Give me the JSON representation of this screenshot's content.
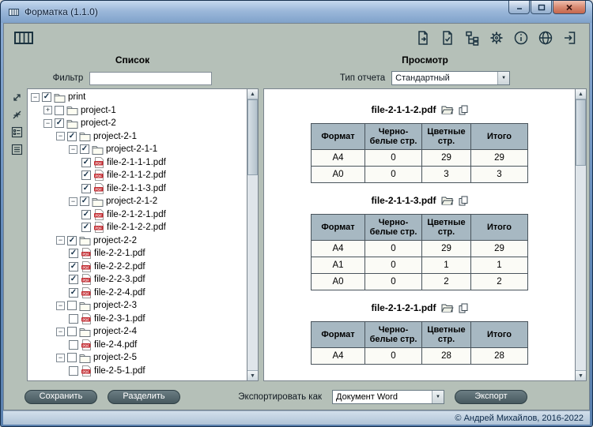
{
  "colors": {
    "frame_blue": "#6f94c0",
    "client_bg": "#b5c0b8",
    "table_header_bg": "#a7b8c2",
    "dark_button": "#51656b",
    "pdf_red": "#c1272d"
  },
  "window": {
    "title": "Форматка (1.1.0)",
    "controls": [
      "minimize-button",
      "maximize-button",
      "close-button"
    ]
  },
  "toolbar": {
    "icons": [
      "document-export-icon",
      "document-check-icon",
      "tree-structure-icon",
      "settings-gear-icon",
      "info-icon",
      "globe-icon",
      "exit-icon"
    ]
  },
  "left_panel": {
    "title": "Список",
    "filter_label": "Фильтр",
    "filter_value": "",
    "tools": [
      "expand-all-icon",
      "collapse-all-icon",
      "check-all-icon",
      "uncheck-all-icon"
    ],
    "tree": [
      {
        "label": "print",
        "type": "folder",
        "level": 0,
        "expander": "minus",
        "checked": true
      },
      {
        "label": "project-1",
        "type": "folder",
        "level": 1,
        "expander": "plus",
        "checked": false
      },
      {
        "label": "project-2",
        "type": "folder",
        "level": 1,
        "expander": "minus",
        "checked": true
      },
      {
        "label": "project-2-1",
        "type": "folder",
        "level": 2,
        "expander": "minus",
        "checked": true
      },
      {
        "label": "project-2-1-1",
        "type": "folder",
        "level": 3,
        "expander": "minus",
        "checked": true
      },
      {
        "label": "file-2-1-1-1.pdf",
        "type": "pdf",
        "level": 4,
        "checked": true
      },
      {
        "label": "file-2-1-1-2.pdf",
        "type": "pdf",
        "level": 4,
        "checked": true
      },
      {
        "label": "file-2-1-1-3.pdf",
        "type": "pdf",
        "level": 4,
        "checked": true
      },
      {
        "label": "project-2-1-2",
        "type": "folder",
        "level": 3,
        "expander": "minus",
        "checked": true
      },
      {
        "label": "file-2-1-2-1.pdf",
        "type": "pdf",
        "level": 4,
        "checked": true
      },
      {
        "label": "file-2-1-2-2.pdf",
        "type": "pdf",
        "level": 4,
        "checked": true
      },
      {
        "label": "project-2-2",
        "type": "folder",
        "level": 2,
        "expander": "minus",
        "checked": true
      },
      {
        "label": "file-2-2-1.pdf",
        "type": "pdf",
        "level": 3,
        "checked": true
      },
      {
        "label": "file-2-2-2.pdf",
        "type": "pdf",
        "level": 3,
        "checked": true
      },
      {
        "label": "file-2-2-3.pdf",
        "type": "pdf",
        "level": 3,
        "checked": true
      },
      {
        "label": "file-2-2-4.pdf",
        "type": "pdf",
        "level": 3,
        "checked": true
      },
      {
        "label": "project-2-3",
        "type": "folder",
        "level": 2,
        "expander": "minus",
        "checked": false
      },
      {
        "label": "file-2-3-1.pdf",
        "type": "pdf",
        "level": 3,
        "checked": false
      },
      {
        "label": "project-2-4",
        "type": "folder",
        "level": 2,
        "expander": "minus",
        "checked": false
      },
      {
        "label": "file-2-4.pdf",
        "type": "pdf",
        "level": 3,
        "checked": false
      },
      {
        "label": "project-2-5",
        "type": "folder",
        "level": 2,
        "expander": "minus",
        "checked": false
      },
      {
        "label": "file-2-5-1.pdf",
        "type": "pdf",
        "level": 3,
        "checked": false
      }
    ]
  },
  "right_panel": {
    "title": "Просмотр",
    "report_type_label": "Тип отчета",
    "report_type_value": "Стандартный",
    "table_headers": [
      "Формат",
      "Черно-белые стр.",
      "Цветные стр.",
      "Итого"
    ],
    "reports": [
      {
        "filename": "file-2-1-1-2.pdf",
        "rows": [
          [
            "A4",
            "0",
            "29",
            "29"
          ],
          [
            "A0",
            "0",
            "3",
            "3"
          ]
        ]
      },
      {
        "filename": "file-2-1-1-3.pdf",
        "rows": [
          [
            "A4",
            "0",
            "29",
            "29"
          ],
          [
            "A1",
            "0",
            "1",
            "1"
          ],
          [
            "A0",
            "0",
            "2",
            "2"
          ]
        ]
      },
      {
        "filename": "file-2-1-2-1.pdf",
        "rows": [
          [
            "A4",
            "0",
            "28",
            "28"
          ]
        ]
      }
    ]
  },
  "bottom_bar": {
    "save_label": "Сохранить",
    "split_label": "Разделить",
    "export_as_label": "Экспортировать как",
    "export_format_value": "Документ Word",
    "export_label": "Экспорт"
  },
  "status_bar": {
    "copyright": "© Андрей Михайлов, 2016-2022"
  }
}
